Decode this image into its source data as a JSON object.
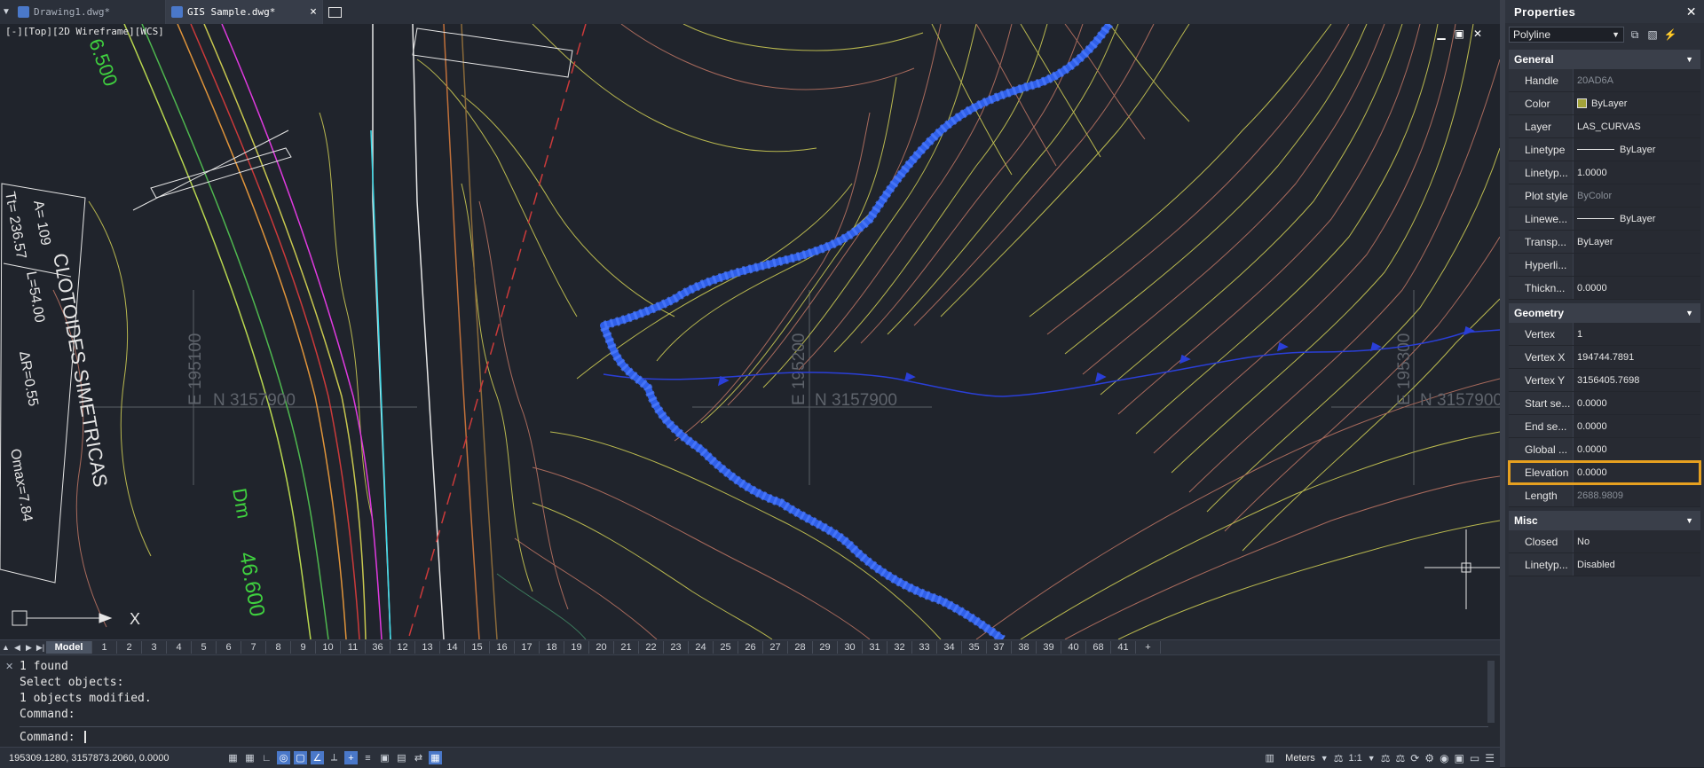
{
  "tabs": {
    "items": [
      {
        "label": "Drawing1.dwg*",
        "active": false
      },
      {
        "label": "GIS Sample.dwg*",
        "active": true
      }
    ],
    "close_glyph": "×"
  },
  "viewport": {
    "label": "[-][Top][2D Wireframe][WCS]",
    "drawing_text": {
      "grid_e1": "E 195100",
      "grid_e2": "E 195200",
      "grid_e3": "E 195300",
      "grid_n1": "N 3157900",
      "grid_n2": "N 3157900",
      "grid_n3": "N 3157900",
      "contour_top": "6.500",
      "contour_bottom": "46.600",
      "dm": "Dm",
      "clot_title": "CLOTOIDES SIMETRICAS",
      "clot_a": "A= 109",
      "clot_l": "L=54.00",
      "clot_r": "ΔR=0.55",
      "clot_t": "Tt= 236.57",
      "clot_o": "Omax=7.84",
      "ucs_x": "X"
    }
  },
  "layout_tabs": [
    "Model",
    "1",
    "2",
    "3",
    "4",
    "5",
    "6",
    "7",
    "8",
    "9",
    "10",
    "11",
    "36",
    "12",
    "13",
    "14",
    "15",
    "16",
    "17",
    "18",
    "19",
    "20",
    "21",
    "22",
    "23",
    "24",
    "25",
    "26",
    "27",
    "28",
    "29",
    "30",
    "31",
    "32",
    "33",
    "34",
    "35",
    "37",
    "38",
    "39",
    "40",
    "68",
    "41",
    "+"
  ],
  "command": {
    "history": [
      "1 found",
      "Select objects:",
      "1 objects modified.",
      "Command:"
    ],
    "prompt": "Command:"
  },
  "status": {
    "coords": "195309.1280, 3157873.2060, 0.0000",
    "units": "Meters",
    "scale": "1:1"
  },
  "properties": {
    "title": "Properties",
    "entity_type": "Polyline",
    "sections": {
      "general": {
        "title": "General",
        "handle": {
          "name": "Handle",
          "value": "20AD6A"
        },
        "color": {
          "name": "Color",
          "value": "ByLayer"
        },
        "layer": {
          "name": "Layer",
          "value": "LAS_CURVAS"
        },
        "linetype": {
          "name": "Linetype",
          "value": "ByLayer"
        },
        "linetype_scale": {
          "name": "Linetyp...",
          "value": "1.0000"
        },
        "plot_style": {
          "name": "Plot style",
          "value": "ByColor"
        },
        "lineweight": {
          "name": "Linewe...",
          "value": "ByLayer"
        },
        "transparency": {
          "name": "Transp...",
          "value": "ByLayer"
        },
        "hyperlink": {
          "name": "Hyperli...",
          "value": ""
        },
        "thickness": {
          "name": "Thickn...",
          "value": "0.0000"
        }
      },
      "geometry": {
        "title": "Geometry",
        "vertex": {
          "name": "Vertex",
          "value": "1"
        },
        "vertex_x": {
          "name": "Vertex X",
          "value": "194744.7891"
        },
        "vertex_y": {
          "name": "Vertex Y",
          "value": "3156405.7698"
        },
        "start_segment": {
          "name": "Start se...",
          "value": "0.0000"
        },
        "end_segment": {
          "name": "End se...",
          "value": "0.0000"
        },
        "global_width": {
          "name": "Global ...",
          "value": "0.0000"
        },
        "elevation": {
          "name": "Elevation",
          "value": "0.0000"
        },
        "length": {
          "name": "Length",
          "value": "2688.9809"
        }
      },
      "misc": {
        "title": "Misc",
        "closed": {
          "name": "Closed",
          "value": "No"
        },
        "linetype_gen": {
          "name": "Linetyp...",
          "value": "Disabled"
        }
      }
    }
  },
  "colors": {
    "background": "#20242c",
    "selection": "#2f5fe8",
    "contour_yellow": "#b9b84f",
    "contour_red": "#a86a5c",
    "highlight": "#e6a020"
  }
}
